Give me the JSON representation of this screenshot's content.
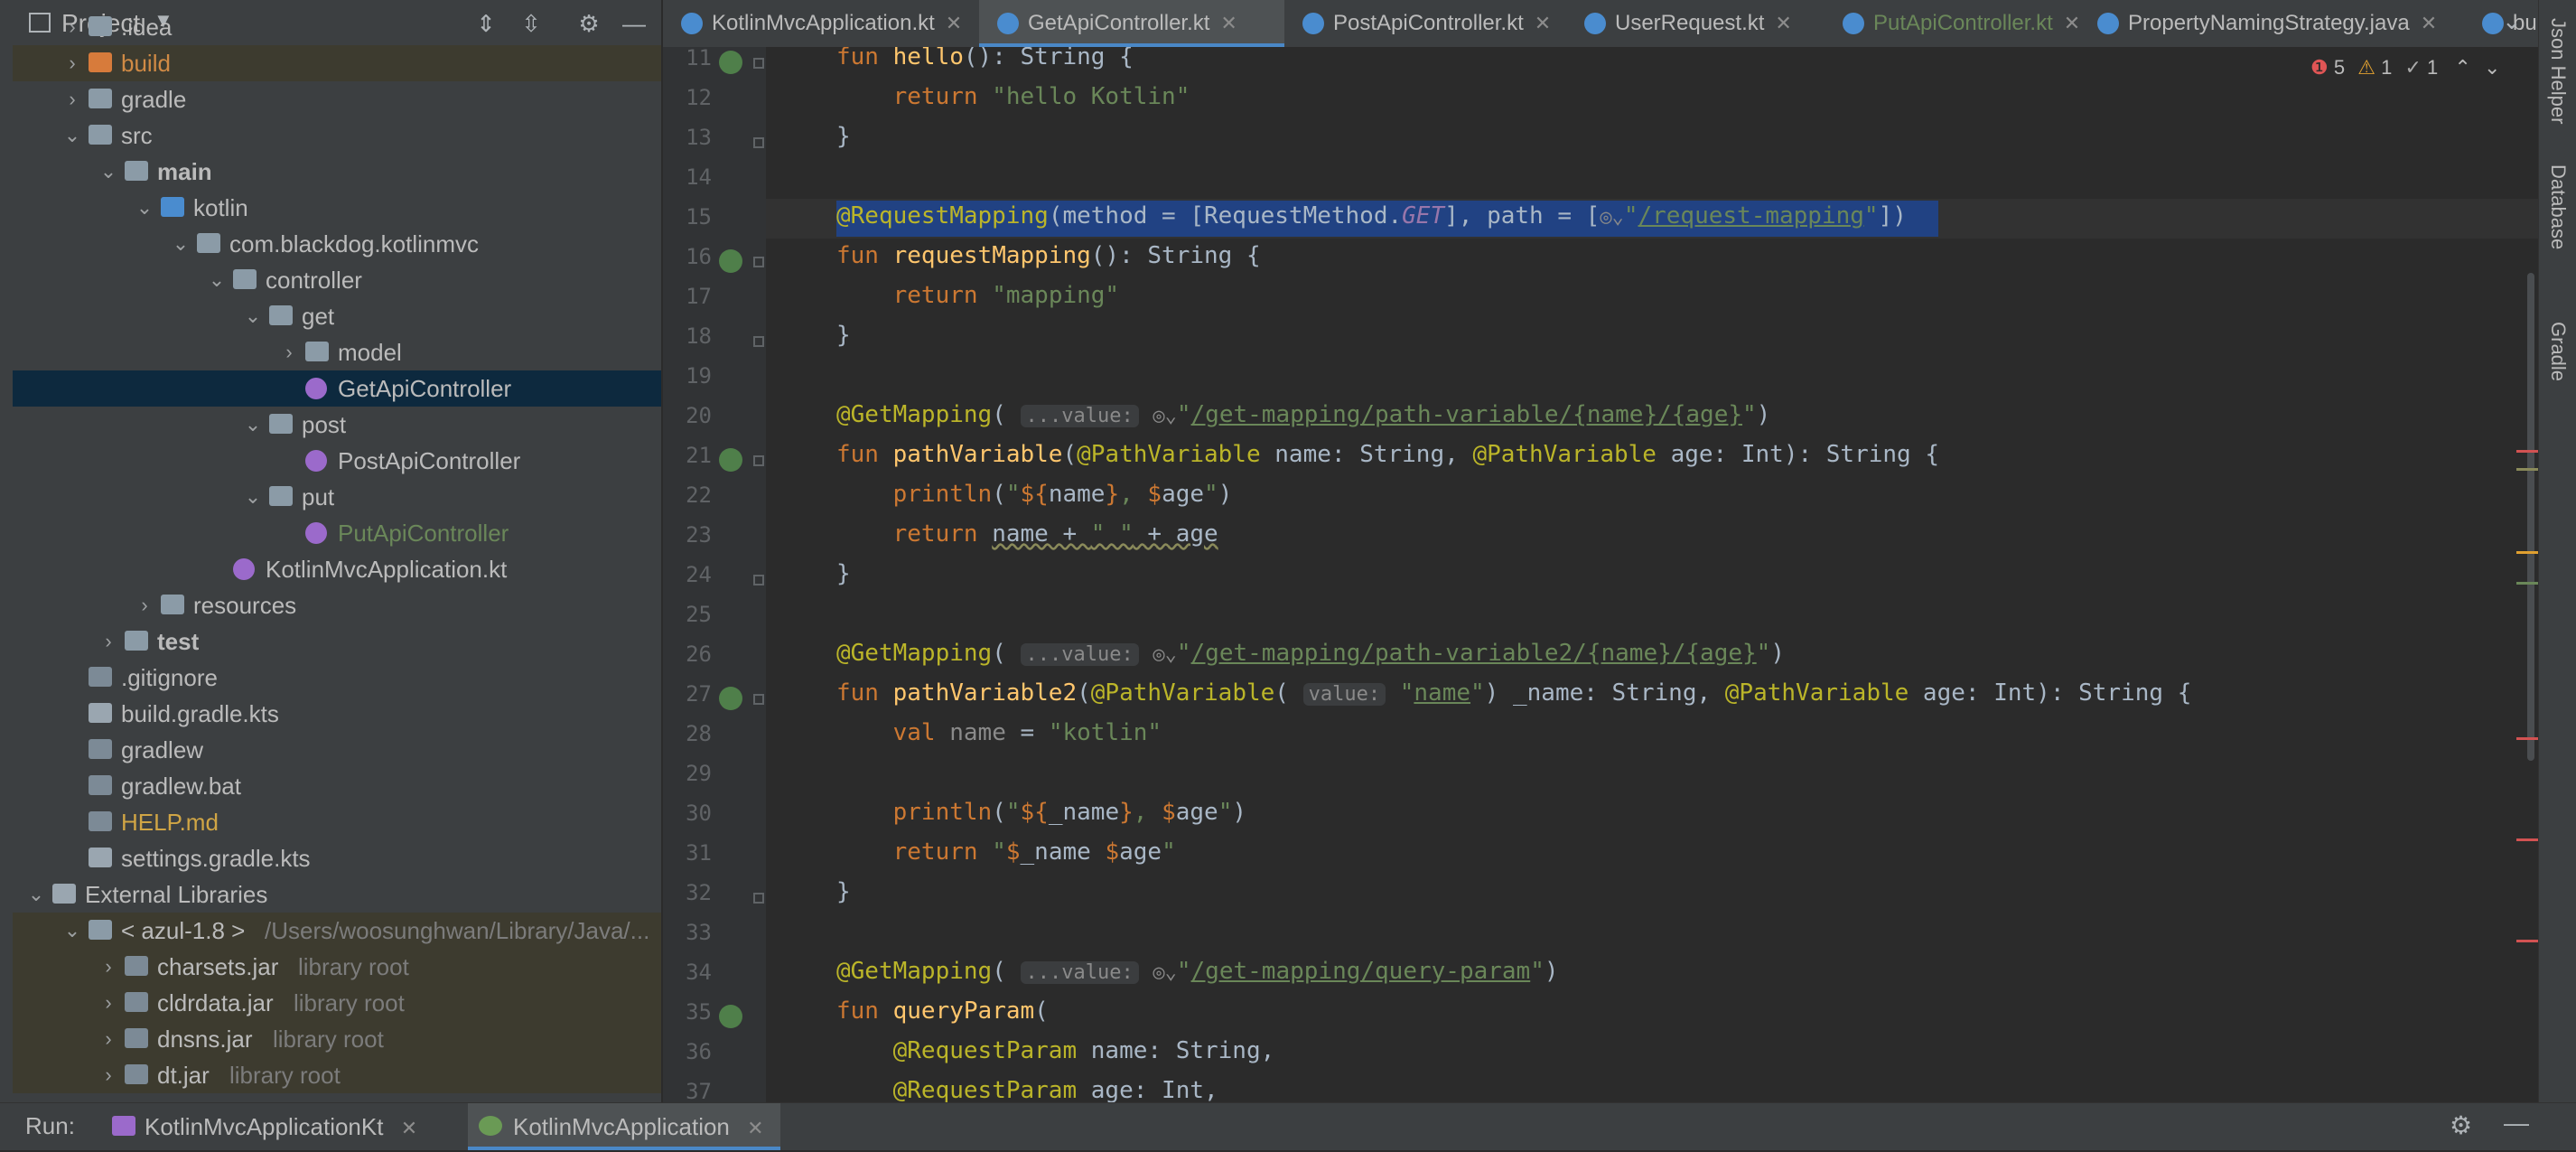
{
  "project_panel": {
    "title": "Project",
    "tree": [
      {
        "label": ".idea",
        "depth": 1,
        "icon": "folder",
        "arrow": ">"
      },
      {
        "label": "build",
        "depth": 1,
        "icon": "folder-orange",
        "arrow": ">",
        "style": "excluded"
      },
      {
        "label": "gradle",
        "depth": 1,
        "icon": "folder",
        "arrow": ">"
      },
      {
        "label": "src",
        "depth": 1,
        "icon": "folder",
        "arrow": "v"
      },
      {
        "label": "main",
        "depth": 2,
        "icon": "folder",
        "arrow": "v",
        "bold": true
      },
      {
        "label": "kotlin",
        "depth": 3,
        "icon": "folder-blue",
        "arrow": "v"
      },
      {
        "label": "com.blackdog.kotlinmvc",
        "depth": 4,
        "icon": "package",
        "arrow": "v"
      },
      {
        "label": "controller",
        "depth": 5,
        "icon": "package",
        "arrow": "v"
      },
      {
        "label": "get",
        "depth": 6,
        "icon": "package",
        "arrow": "v"
      },
      {
        "label": "model",
        "depth": 7,
        "icon": "package",
        "arrow": ">"
      },
      {
        "label": "GetApiController",
        "depth": 7,
        "icon": "kotlin-class",
        "selected": true
      },
      {
        "label": "post",
        "depth": 6,
        "icon": "package",
        "arrow": "v"
      },
      {
        "label": "PostApiController",
        "depth": 7,
        "icon": "kotlin-class"
      },
      {
        "label": "put",
        "depth": 6,
        "icon": "package",
        "arrow": "v"
      },
      {
        "label": "PutApiController",
        "depth": 7,
        "icon": "kotlin-class",
        "color": "#6a8759"
      },
      {
        "label": "KotlinMvcApplication.kt",
        "depth": 5,
        "icon": "kotlin-file"
      },
      {
        "label": "resources",
        "depth": 3,
        "icon": "folder",
        "arrow": ">"
      },
      {
        "label": "test",
        "depth": 2,
        "icon": "folder",
        "arrow": ">",
        "bold": true
      },
      {
        "label": ".gitignore",
        "depth": 1,
        "icon": "file"
      },
      {
        "label": "build.gradle.kts",
        "depth": 1,
        "icon": "gradle-file"
      },
      {
        "label": "gradlew",
        "depth": 1,
        "icon": "file"
      },
      {
        "label": "gradlew.bat",
        "depth": 1,
        "icon": "file"
      },
      {
        "label": "HELP.md",
        "depth": 1,
        "icon": "md-file",
        "color": "#d0a545"
      },
      {
        "label": "settings.gradle.kts",
        "depth": 1,
        "icon": "gradle-file"
      },
      {
        "label": "External Libraries",
        "depth": 0,
        "icon": "library",
        "arrow": "v"
      },
      {
        "label": "< azul-1.8 >",
        "depth": 1,
        "icon": "jdk",
        "arrow": "v",
        "hint": "/Users/woosunghwan/Library/Java/...",
        "style": "library"
      },
      {
        "label": "charsets.jar",
        "depth": 2,
        "icon": "jar",
        "arrow": ">",
        "hint": "library root",
        "style": "library"
      },
      {
        "label": "cldrdata.jar",
        "depth": 2,
        "icon": "jar",
        "arrow": ">",
        "hint": "library root",
        "style": "library"
      },
      {
        "label": "dnsns.jar",
        "depth": 2,
        "icon": "jar",
        "arrow": ">",
        "hint": "library root",
        "style": "library"
      },
      {
        "label": "dt.jar",
        "depth": 2,
        "icon": "jar",
        "arrow": ">",
        "hint": "library root",
        "style": "library"
      }
    ]
  },
  "tabs": [
    {
      "label": "KotlinMvcApplication.kt",
      "active": false
    },
    {
      "label": "GetApiController.kt",
      "active": true
    },
    {
      "label": "PostApiController.kt",
      "active": false
    },
    {
      "label": "UserRequest.kt",
      "active": false
    },
    {
      "label": "PutApiController.kt",
      "active": false,
      "color": "#6a8759"
    },
    {
      "label": "PropertyNamingStrategy.java",
      "active": false
    },
    {
      "label": "build.gr",
      "active": false
    }
  ],
  "inspections": {
    "errors": "5",
    "warnings": "1",
    "weak": "1"
  },
  "editor": {
    "line_numbers": [
      "11",
      "12",
      "13",
      "14",
      "15",
      "16",
      "17",
      "18",
      "19",
      "20",
      "21",
      "22",
      "23",
      "24",
      "25",
      "26",
      "27",
      "28",
      "29",
      "30",
      "31",
      "32",
      "33",
      "34",
      "35",
      "36",
      "37"
    ]
  },
  "right_tools": [
    "Json Helper",
    "Database",
    "Gradle"
  ],
  "run_bar": {
    "label": "Run:",
    "tabs": [
      {
        "label": "KotlinMvcApplicationKt"
      },
      {
        "label": "KotlinMvcApplication"
      }
    ]
  }
}
